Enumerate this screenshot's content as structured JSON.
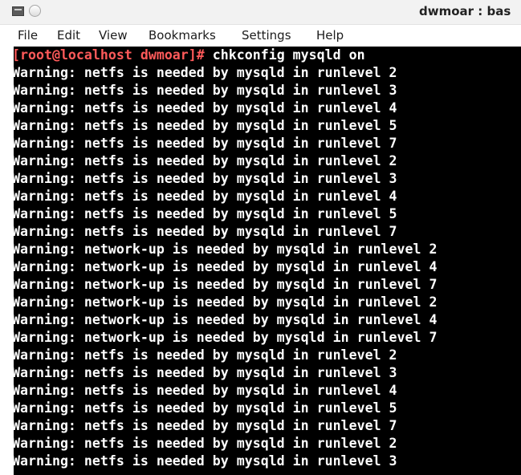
{
  "window": {
    "title": "dwmoar : bas"
  },
  "menu": {
    "items": [
      "File",
      "Edit",
      "View",
      "Bookmarks",
      "Settings",
      "Help"
    ]
  },
  "terminal": {
    "prompt": "[root@localhost dwmoar]# ",
    "command": "chkconfig mysqld on",
    "lines": [
      "Warning: netfs is needed by mysqld in runlevel 2",
      "Warning: netfs is needed by mysqld in runlevel 3",
      "Warning: netfs is needed by mysqld in runlevel 4",
      "Warning: netfs is needed by mysqld in runlevel 5",
      "Warning: netfs is needed by mysqld in runlevel 7",
      "Warning: netfs is needed by mysqld in runlevel 2",
      "Warning: netfs is needed by mysqld in runlevel 3",
      "Warning: netfs is needed by mysqld in runlevel 4",
      "Warning: netfs is needed by mysqld in runlevel 5",
      "Warning: netfs is needed by mysqld in runlevel 7",
      "Warning: network-up is needed by mysqld in runlevel 2",
      "Warning: network-up is needed by mysqld in runlevel 4",
      "Warning: network-up is needed by mysqld in runlevel 7",
      "Warning: network-up is needed by mysqld in runlevel 2",
      "Warning: network-up is needed by mysqld in runlevel 4",
      "Warning: network-up is needed by mysqld in runlevel 7",
      "Warning: netfs is needed by mysqld in runlevel 2",
      "Warning: netfs is needed by mysqld in runlevel 3",
      "Warning: netfs is needed by mysqld in runlevel 4",
      "Warning: netfs is needed by mysqld in runlevel 5",
      "Warning: netfs is needed by mysqld in runlevel 7",
      "Warning: netfs is needed by mysqld in runlevel 2",
      "Warning: netfs is needed by mysqld in runlevel 3"
    ]
  },
  "colors": {
    "terminal_background": "#000000",
    "terminal_text": "#ffffff",
    "prompt": "#ff5a5a"
  },
  "icons": {
    "window_menu": "terminal-window-icon",
    "window_button": "window-circle-icon"
  }
}
